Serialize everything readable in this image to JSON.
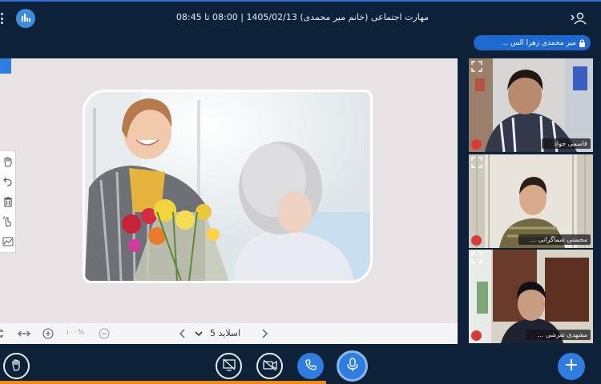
{
  "header": {
    "title": "مهارت اجتماعی (خانم میر محمدی) 1405/02/13 | 08:00 تا 08:45",
    "menu_icon": "vertical-dots-icon",
    "logo_icon": "bars-logo-icon",
    "user_icon": "user-settings-icon"
  },
  "presenter": {
    "name": "میر محمدی زهرا الس ...",
    "icon": "lock-icon"
  },
  "board": {
    "tools": [
      "hand-icon",
      "undo-icon",
      "trash-icon",
      "pointer-icon",
      "chart-icon"
    ],
    "zoom_value": "۱۰۰%",
    "slide_label": "اسلاید 5",
    "slide_image": "woman-giving-flowers-to-elderly-woman"
  },
  "webcams": [
    {
      "name": "قاسمی جواد",
      "muted": true
    },
    {
      "name": "محسنی شماگرانی ...",
      "muted": true
    },
    {
      "name": "مشهدی تفرشی ...",
      "muted": true
    }
  ],
  "controls": {
    "raise_hand": "raise-hand-icon",
    "screen_share": "screen-share-off-icon",
    "camera": "camera-off-icon",
    "call": "phone-icon",
    "mic": "microphone-icon",
    "add": "plus-icon"
  },
  "colors": {
    "background": "#0d2238",
    "accent": "#2f7de0",
    "progress": "#f08a17",
    "muted": "#d83a3a"
  }
}
